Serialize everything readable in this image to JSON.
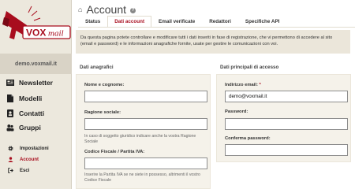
{
  "brand": {
    "logo_text": "VOXmail",
    "logo_prefix": "VOX",
    "logo_suffix": "mail",
    "accent": "#a80d1e"
  },
  "site": "demo.voxmail.it",
  "nav_main": [
    {
      "label": "Newsletter",
      "icon": "newsletter-icon"
    },
    {
      "label": "Modelli",
      "icon": "file-icon"
    },
    {
      "label": "Contatti",
      "icon": "address-book-icon"
    },
    {
      "label": "Gruppi",
      "icon": "users-icon"
    }
  ],
  "nav_sub": [
    {
      "label": "Impostazioni",
      "icon": "gear-icon",
      "active": false
    },
    {
      "label": "Account",
      "icon": "user-icon",
      "active": true
    },
    {
      "label": "Esci",
      "icon": "logout-icon",
      "active": false
    }
  ],
  "page": {
    "title": "Account"
  },
  "tabs": [
    {
      "label": "Status",
      "active": false
    },
    {
      "label": "Dati account",
      "active": true
    },
    {
      "label": "Email verificate",
      "active": false
    },
    {
      "label": "Redattori",
      "active": false
    },
    {
      "label": "Specifiche API",
      "active": false
    }
  ],
  "info": "Da questa pagina potete controllare e modificare tutti i dati inseriti in fase di registrazione, che vi permettono di accedere al sito (email e password) e le informazioni anagrafiche fornite, usate per gestire le comunicazioni con voi.",
  "anagrafici": {
    "heading": "Dati anagrafici",
    "nome_label": "Nome e cognome:",
    "nome_value": "",
    "ragione_label": "Ragione sociale:",
    "ragione_value": "",
    "ragione_help": "In caso di soggetto giuridico indicare anche la vostra Ragione Sociale",
    "fiscale_label": "Codice Fiscale / Partita IVA:",
    "fiscale_value": "",
    "fiscale_help": "Inserire la Partita IVA se ne siete in possesso, altrimenti il vostro Codice Fiscale"
  },
  "accesso": {
    "heading": "Dati principali di accesso",
    "email_label": "Indirizzo email:",
    "required_mark": "*",
    "email_value": "demo@voxmail.it",
    "password_label": "Password:",
    "password_value": "",
    "confirm_label": "Conferma password:",
    "confirm_value": ""
  }
}
